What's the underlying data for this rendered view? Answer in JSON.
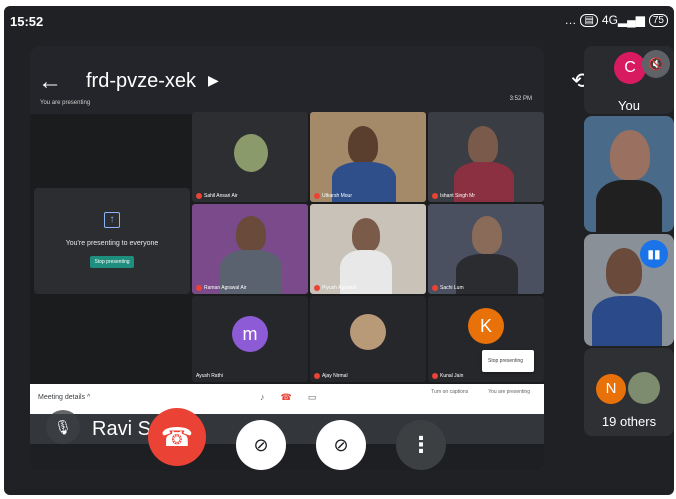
{
  "status_bar": {
    "time": "15:52",
    "network": "4G",
    "battery": "75"
  },
  "meeting": {
    "code": "frd-pvze-xek",
    "presenting_small": "You are presenting",
    "header_mini": "3:52 PM"
  },
  "presentation": {
    "presenting_text": "You're presenting to everyone",
    "stop_button": "Stop presenting",
    "stop_popup": "Stop presenting"
  },
  "grid": {
    "tiles": [
      {
        "name": "Sahil Ansari Air"
      },
      {
        "name": "Utkarsh Mour"
      },
      {
        "name": "Ishant Singh Mr"
      },
      {
        "name": "Raman Agrawal Air"
      },
      {
        "name": "Piyush Agrawal"
      },
      {
        "name": "Sachi Lum"
      },
      {
        "name": "Ayush Rathi",
        "initial": "m"
      },
      {
        "name": "Ajay Nirmal"
      },
      {
        "name": "Kunal Jain",
        "initial": "K"
      }
    ]
  },
  "toolbar": {
    "meeting_details": "Meeting details",
    "captions": "Turn on captions",
    "presenting": "You are presenting"
  },
  "self_view": {
    "name": "Ravi Sv"
  },
  "sidebar": {
    "you_label": "You",
    "you_initial": "C",
    "others_label": "19 others",
    "others_initial": "N"
  },
  "colors": {
    "end_call": "#ea4335",
    "accent": "#1a73e8",
    "you_avatar": "#d81b60"
  }
}
